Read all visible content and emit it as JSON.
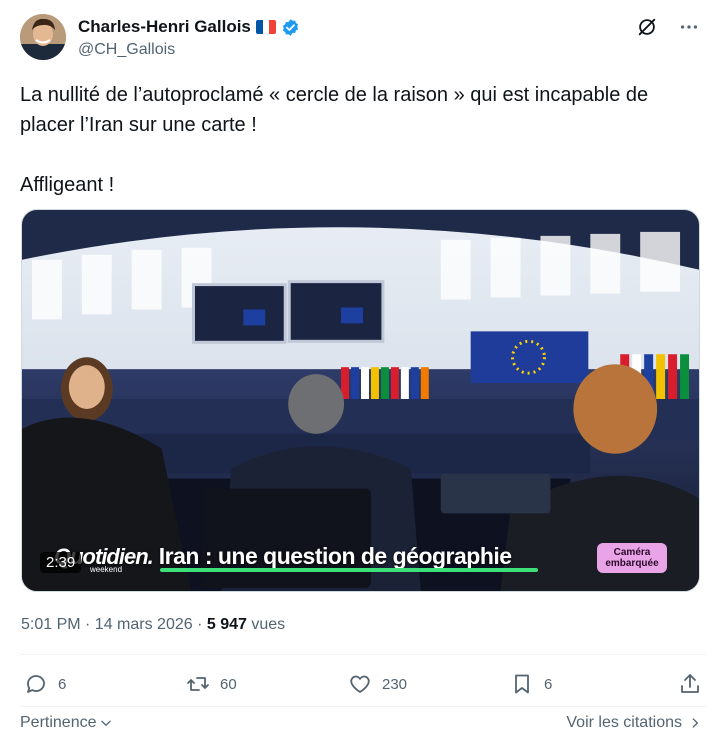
{
  "author": {
    "display_name": "Charles-Henri Gallois",
    "handle": "@CH_Gallois",
    "flag_colors": [
      "#0055a4",
      "#ffffff",
      "#ef4135"
    ],
    "verified_color": "#1d9bf0"
  },
  "tweet": {
    "text": "La nullité de l’autoproclamé « cercle de la raison » qui est incapable de placer l’Iran sur une carte !\n\nAffligeant !"
  },
  "video": {
    "duration": "2:39",
    "brand": "Quotidien.",
    "brand_sub": "weekend",
    "caption": "Iran : une question de géographie",
    "badge": "Caméra embarquée"
  },
  "meta": {
    "time": "5:01 PM · 14 mars 2026 · ",
    "views_count": "5 947",
    "views_label": " vues"
  },
  "actions": {
    "replies": "6",
    "reposts": "60",
    "likes": "230",
    "bookmarks": "6"
  },
  "footer": {
    "sort_label": "Pertinence",
    "quotes_label": "Voir les citations"
  }
}
